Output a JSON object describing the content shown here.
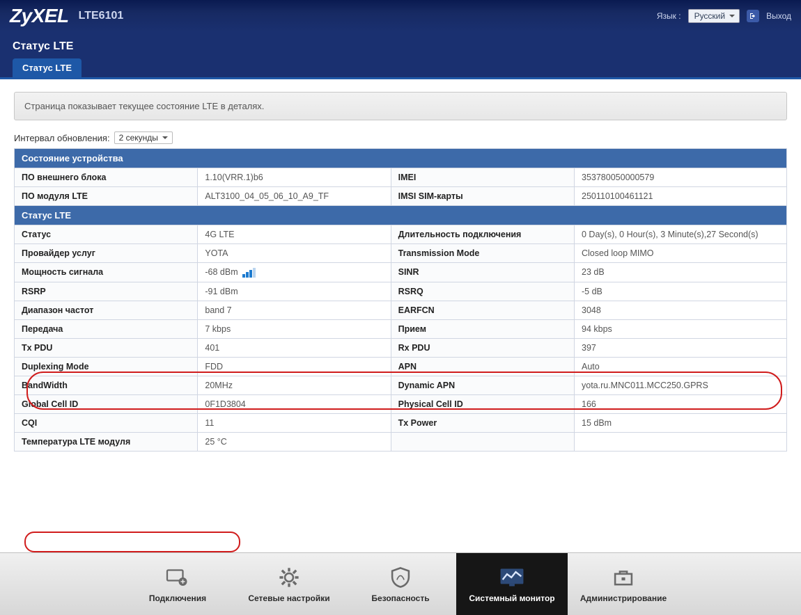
{
  "header": {
    "brand": "ZyXEL",
    "model": "LTE6101",
    "lang_label": "Язык :",
    "lang_value": "Русский",
    "logout": "Выход"
  },
  "page": {
    "title": "Статус LTE",
    "tab_label": "Статус LTE",
    "info_text": "Страница показывает текущее состояние LTE в деталях.",
    "refresh_label": "Интервал обновления:",
    "refresh_value": "2 секунды"
  },
  "section1_head": "Состояние устройства",
  "section1": [
    {
      "k": "ПО внешнего блока",
      "v": "1.10(VRR.1)b6",
      "k2": "IMEI",
      "v2": "353780050000579"
    },
    {
      "k": "ПО модуля LTE",
      "v": "ALT3100_04_05_06_10_A9_TF",
      "k2": "IMSI SIM-карты",
      "v2": "250110100461121"
    }
  ],
  "section2_head": "Статус LTE",
  "section2": [
    {
      "k": "Статус",
      "v": "4G LTE",
      "k2": "Длительность подключения",
      "v2": "0 Day(s), 0 Hour(s), 3 Minute(s),27 Second(s)"
    },
    {
      "k": "Провайдер услуг",
      "v": "YOTA",
      "k2": "Transmission Mode",
      "v2": "Closed loop MIMO"
    },
    {
      "k": "Мощность сигнала",
      "v": "-68 dBm",
      "signal": true,
      "k2": "SINR",
      "v2": "23 dB"
    },
    {
      "k": "RSRP",
      "v": "-91 dBm",
      "k2": "RSRQ",
      "v2": "-5 dB"
    },
    {
      "k": "Диапазон частот",
      "v": "band 7",
      "k2": "EARFCN",
      "v2": "3048"
    },
    {
      "k": "Передача",
      "v": "7 kbps",
      "k2": "Прием",
      "v2": "94 kbps"
    },
    {
      "k": "Tx PDU",
      "v": "401",
      "k2": "Rx PDU",
      "v2": "397"
    },
    {
      "k": "Duplexing Mode",
      "v": "FDD",
      "k2": "APN",
      "v2": "Auto"
    },
    {
      "k": "BandWidth",
      "v": "20MHz",
      "k2": "Dynamic APN",
      "v2": "yota.ru.MNC011.MCC250.GPRS"
    },
    {
      "k": "Global Cell ID",
      "v": "0F1D3804",
      "k2": "Physical Cell ID",
      "v2": "166"
    },
    {
      "k": "CQI",
      "v": "11",
      "k2": "Tx Power",
      "v2": "15 dBm"
    },
    {
      "k": "Температура LTE модуля",
      "v": "25 °C",
      "k2": "",
      "v2": ""
    }
  ],
  "nav": [
    {
      "label": "Подключения"
    },
    {
      "label": "Сетевые настройки"
    },
    {
      "label": "Безопасность"
    },
    {
      "label": "Системный монитор"
    },
    {
      "label": "Администрирование"
    }
  ]
}
